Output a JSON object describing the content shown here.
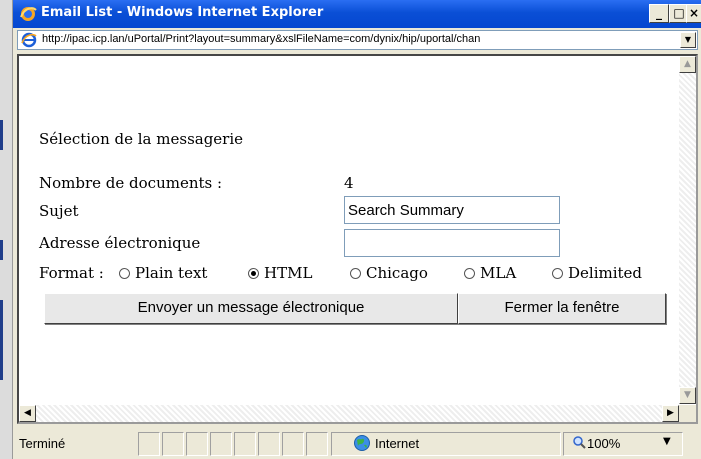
{
  "window": {
    "title": "Email List - Windows Internet Explorer",
    "url": "http://ipac.icp.lan/uPortal/Print?layout=summary&xslFileName=com/dynix/hip/uportal/chan"
  },
  "form": {
    "heading": "Sélection de la messagerie",
    "count_label": "Nombre de documents :",
    "count_value": "4",
    "subject_label": "Sujet",
    "subject_value": "Search Summary",
    "email_label": "Adresse électronique",
    "email_value": "",
    "format_label": "Format :",
    "format_options": [
      "Plain text",
      "HTML",
      "Chicago",
      "MLA",
      "Delimited"
    ],
    "selected_format": "HTML",
    "send_button": "Envoyer un message électronique",
    "close_button": "Fermer la fenêtre"
  },
  "statusbar": {
    "status": "Terminé",
    "zone": "Internet",
    "zoom": "100%"
  },
  "colors": {
    "titlebar": "#0a4fd6",
    "chrome": "#ece9d8",
    "address_border": "#7f9db9"
  },
  "icons": {
    "title": "ie-icon",
    "address": "ie-icon",
    "zone": "globe-icon",
    "zoom": "magnifier-icon"
  }
}
